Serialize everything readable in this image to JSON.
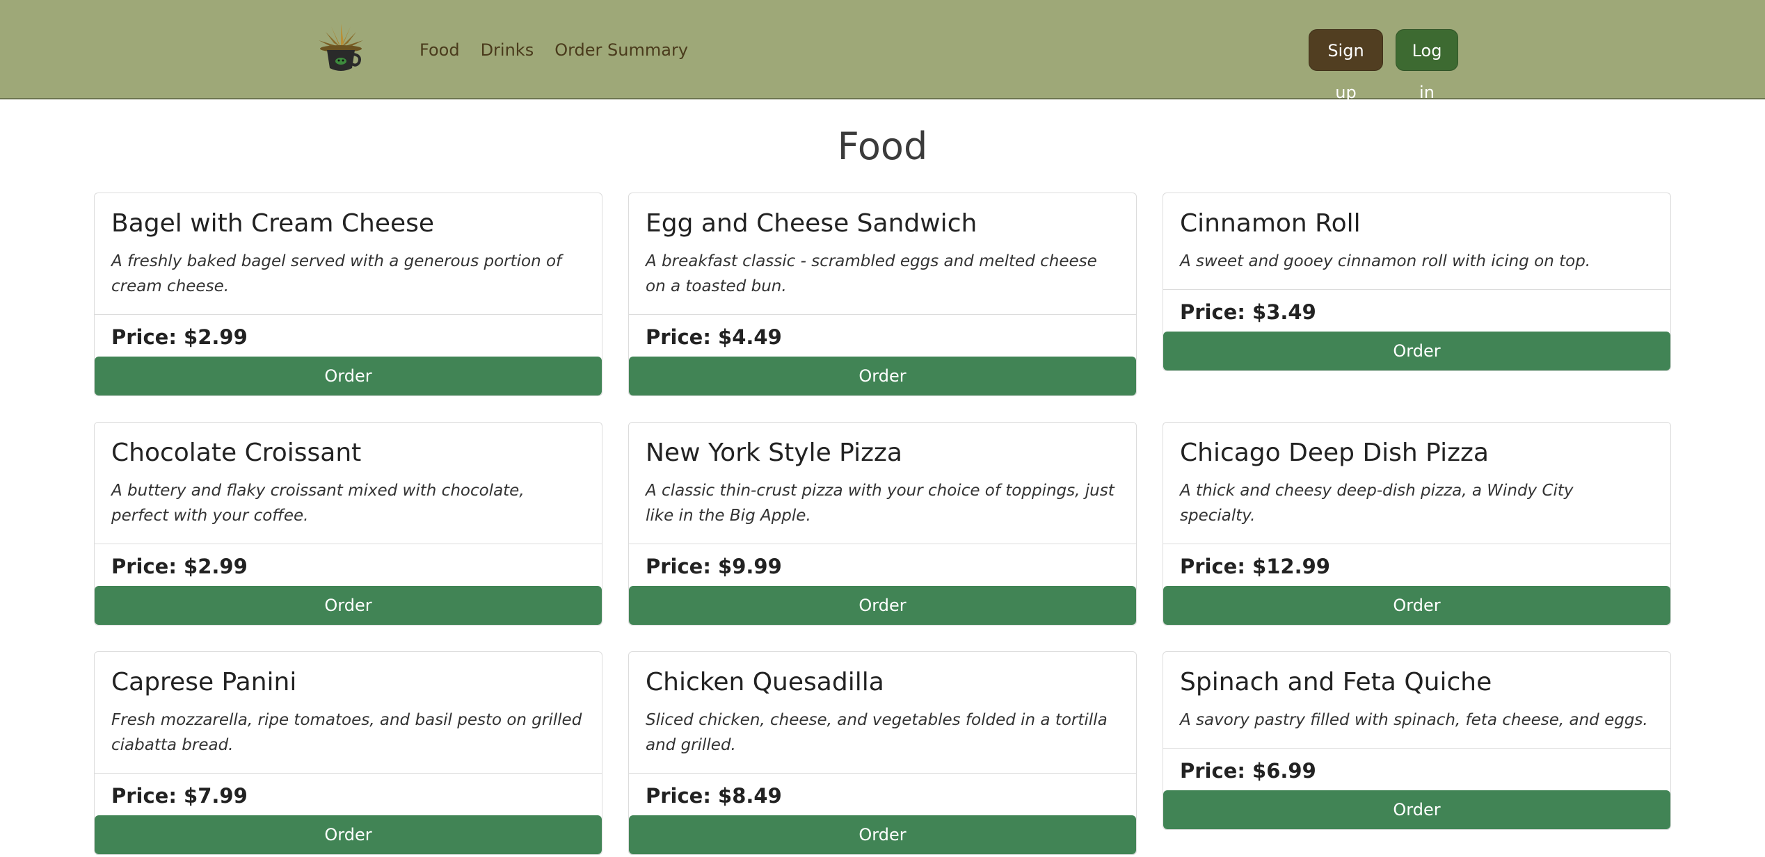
{
  "nav": {
    "logo": "cafe-logo",
    "links": [
      "Food",
      "Drinks",
      "Order Summary"
    ],
    "signup_label": "Sign up",
    "login_label": "Log in"
  },
  "page_title": "Food",
  "items": [
    {
      "title": "Bagel with Cream Cheese",
      "description": "A freshly baked bagel served with a generous portion of cream cheese.",
      "price": "Price: $2.99",
      "order_label": "Order"
    },
    {
      "title": "Egg and Cheese Sandwich",
      "description": "A breakfast classic - scrambled eggs and melted cheese on a toasted bun.",
      "price": "Price: $4.49",
      "order_label": "Order"
    },
    {
      "title": "Cinnamon Roll",
      "description": "A sweet and gooey cinnamon roll with icing on top.",
      "price": "Price: $3.49",
      "order_label": "Order"
    },
    {
      "title": "Chocolate Croissant",
      "description": "A buttery and flaky croissant mixed with chocolate, perfect with your coffee.",
      "price": "Price: $2.99",
      "order_label": "Order"
    },
    {
      "title": "New York Style Pizza",
      "description": "A classic thin-crust pizza with your choice of toppings, just like in the Big Apple.",
      "price": "Price: $9.99",
      "order_label": "Order"
    },
    {
      "title": "Chicago Deep Dish Pizza",
      "description": "A thick and cheesy deep-dish pizza, a Windy City specialty.",
      "price": "Price: $12.99",
      "order_label": "Order"
    },
    {
      "title": "Caprese Panini",
      "description": "Fresh mozzarella, ripe tomatoes, and basil pesto on grilled ciabatta bread.",
      "price": "Price: $7.99",
      "order_label": "Order"
    },
    {
      "title": "Chicken Quesadilla",
      "description": "Sliced chicken, cheese, and vegetables folded in a tortilla and grilled.",
      "price": "Price: $8.49",
      "order_label": "Order"
    },
    {
      "title": "Spinach and Feta Quiche",
      "description": "A savory pastry filled with spinach, feta cheese, and eggs.",
      "price": "Price: $6.99",
      "order_label": "Order"
    }
  ],
  "colors": {
    "navbar": "#9ea878",
    "signup": "#513e21",
    "login": "#3d6a31",
    "order_button": "#418455"
  }
}
